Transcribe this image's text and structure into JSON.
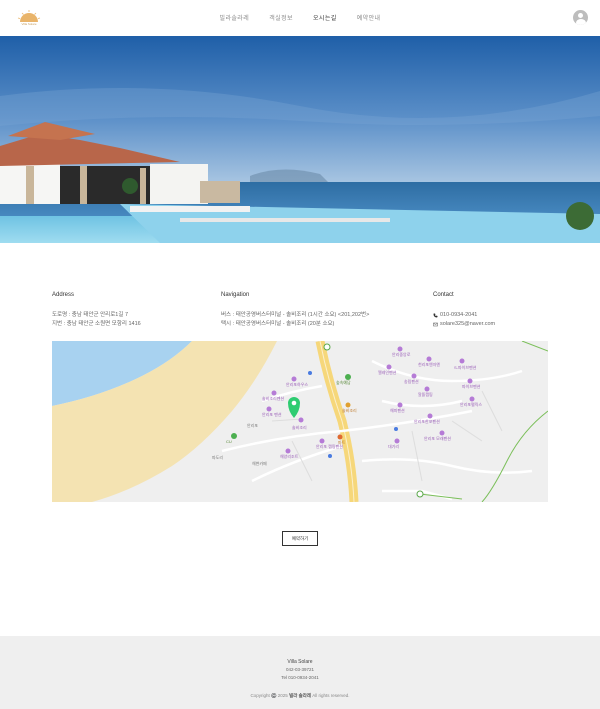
{
  "header": {
    "logo_text": "Villa Solare",
    "nav": [
      {
        "label": "빌라솔라레",
        "active": false
      },
      {
        "label": "객실정보",
        "active": false
      },
      {
        "label": "오시는길",
        "active": true
      },
      {
        "label": "예약안내",
        "active": false
      }
    ]
  },
  "info": {
    "address": {
      "heading": "Address",
      "road": "도로명 : 충남 태안군 안리로1길 7",
      "lot": "지번 : 충남 태안군 소원면 모항리 1416"
    },
    "navigation": {
      "heading": "Navigation",
      "bus": "버스 : 태안공영버스터미널 - 솔비조리 (1시간 소요) <201,202번>",
      "taxi": "택시 : 태안공영버스터미널 - 솔비조리 (20분 소요)"
    },
    "contact": {
      "heading": "Contact",
      "phone": "010-0934-2041",
      "email": "solare325@naver.com"
    }
  },
  "map": {
    "marker_label": "솔비조리",
    "places": [
      {
        "label": "안리중앙로"
      },
      {
        "label": "천리포엔자엔"
      },
      {
        "label": "엘레인펜션"
      },
      {
        "label": "S-파이브펜션"
      },
      {
        "label": "소원면"
      },
      {
        "label": "송림펜션"
      },
      {
        "label": "파이브펜션"
      },
      {
        "label": "안리포펠릭스"
      },
      {
        "label": "안리포향해"
      },
      {
        "label": "숲속예담"
      },
      {
        "label": "안리포하우스"
      },
      {
        "label": "알뜰캠핑"
      },
      {
        "label": "해피펜션"
      },
      {
        "label": "안리해수욕장"
      },
      {
        "label": "안리포한포펜션"
      },
      {
        "label": "안리포 모래펜션"
      },
      {
        "label": "안리포 한포펜션"
      },
      {
        "label": "대기리"
      },
      {
        "label": "솔비조리펜션"
      },
      {
        "label": "안리포 펜션"
      },
      {
        "label": "솔비조리"
      },
      {
        "label": "마트"
      },
      {
        "label": "안리포"
      },
      {
        "label": "파도리"
      },
      {
        "label": "CU"
      },
      {
        "label": "해변카페"
      },
      {
        "label": "해양리조트"
      },
      {
        "label": "안리포 캠핑펜션"
      }
    ]
  },
  "reserve": {
    "label": "예약하기"
  },
  "footer": {
    "name": "Villa Solare",
    "phone": "042-03-39721",
    "tel": "Tel 010-0934-2041",
    "copyright_prefix": "Copyright ©️ 2025",
    "copyright_brand": "빌라 솔라레",
    "copyright_suffix": "All rights reserved."
  },
  "colors": {
    "accent": "#c8a063",
    "map_water": "#a8d2f0",
    "map_sand": "#f4e3b2",
    "map_marker": "#2ecc71",
    "footer_bg": "#efefef"
  }
}
